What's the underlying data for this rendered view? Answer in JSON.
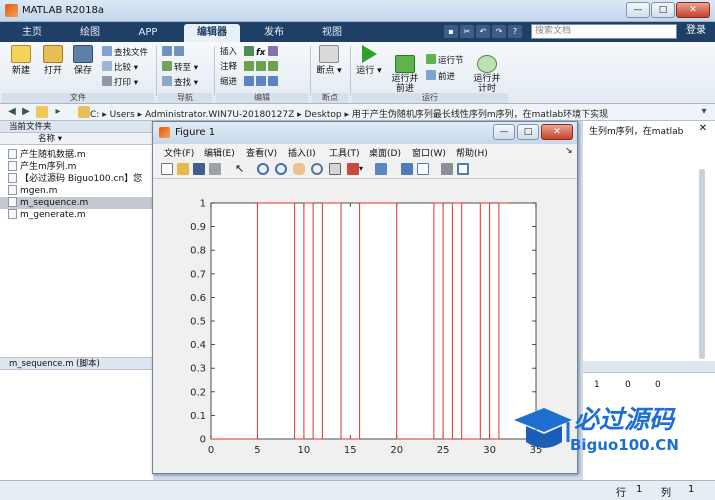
{
  "window": {
    "title": "MATLAB R2018a",
    "min": "—",
    "max": "□",
    "close": "✕"
  },
  "tabs": [
    "主页",
    "绘图",
    "APP",
    "编辑器",
    "发布",
    "视图"
  ],
  "active_tab": "编辑器",
  "search": {
    "placeholder": "搜索文档"
  },
  "login": "登录",
  "ribbon": {
    "file": {
      "label": "文件",
      "new": "新建",
      "open": "打开",
      "save": "保存",
      "find_files": "查找文件",
      "compare": "比较",
      "print": "打印"
    },
    "navigate": {
      "label": "导航",
      "goto": "转至",
      "find": "查找"
    },
    "edit": {
      "label": "编辑",
      "insert": "插入",
      "comment": "注释",
      "indent": "缩进",
      "fx": "fx"
    },
    "breakpoints": {
      "label": "断点",
      "breakpoints": "断点"
    },
    "run": {
      "label": "运行",
      "run": "运行",
      "run_advance": "运行并\n前进",
      "run_section": "运行节",
      "advance": "前进",
      "run_time": "运行并\n计时"
    }
  },
  "path": [
    "C:",
    "Users",
    "Administrator.WIN7U-20180127Z",
    "Desktop",
    "用于产生伪随机序列最长线性序列m序列，在matlab环境下实现"
  ],
  "left_panel": {
    "title": "当前文件夹",
    "column": "名称",
    "files": [
      "产生随机数据.m",
      "产生m序列.m",
      "【必过源码 Biguo100.cn】您",
      "mgen.m",
      "m_sequence.m",
      "m_generate.m"
    ],
    "selected": "m_sequence.m",
    "details": "m_sequence.m  (脚本)"
  },
  "right_panel": {
    "title_fragment": "生列m序列，在matlab",
    "values": [
      "1",
      "0",
      "0"
    ]
  },
  "status": {
    "row_label": "行",
    "row": "1",
    "col_label": "列",
    "col": "1"
  },
  "figure": {
    "title": "Figure 1",
    "menu": [
      "文件(F)",
      "编辑(E)",
      "查看(V)",
      "插入(I)",
      "工具(T)",
      "桌面(D)",
      "窗口(W)",
      "帮助(H)"
    ]
  },
  "chart_data": {
    "type": "line",
    "xlim": [
      0,
      35
    ],
    "ylim": [
      0,
      1
    ],
    "xticks": [
      0,
      5,
      10,
      15,
      20,
      25,
      30,
      35
    ],
    "yticks": [
      0,
      0.1,
      0.2,
      0.3,
      0.4,
      0.5,
      0.6,
      0.7,
      0.8,
      0.9,
      1
    ],
    "color": "#e03030",
    "x": [
      0,
      5,
      5,
      9,
      9,
      10,
      10,
      11,
      11,
      12,
      12,
      14,
      14,
      16,
      16,
      20,
      20,
      24,
      24,
      25,
      25,
      26,
      26,
      27,
      27,
      29,
      29,
      30,
      30,
      31,
      31,
      32
    ],
    "y": [
      0,
      0,
      1,
      1,
      0,
      0,
      1,
      1,
      0,
      0,
      1,
      1,
      0,
      0,
      1,
      1,
      0,
      0,
      1,
      1,
      0,
      0,
      1,
      1,
      0,
      0,
      1,
      1,
      0,
      0,
      1,
      1
    ]
  },
  "watermark": {
    "line1": "必过源码",
    "line2": "Biguo100.CN"
  }
}
